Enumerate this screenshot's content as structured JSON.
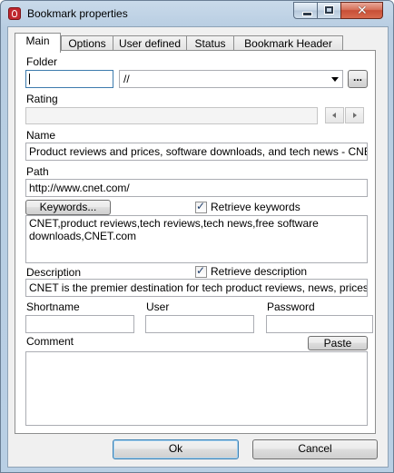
{
  "window": {
    "title": "Bookmark properties"
  },
  "tabs": [
    "Main",
    "Options",
    "User defined",
    "Status",
    "Bookmark Header"
  ],
  "folder": {
    "label": "Folder",
    "path": "//",
    "browse_label": "..."
  },
  "rating": {
    "label": "Rating"
  },
  "name": {
    "label": "Name",
    "value": "Product reviews and prices, software downloads, and tech news - CNET"
  },
  "path": {
    "label": "Path",
    "value": "http://www.cnet.com/"
  },
  "keywords": {
    "button_label": "Keywords...",
    "retrieve_label": "Retrieve keywords",
    "value": "CNET,product reviews,tech reviews,tech news,free software downloads,CNET.com"
  },
  "description": {
    "label": "Description",
    "retrieve_label": "Retrieve description",
    "value": "CNET is the premier destination for tech product reviews, news, prices, videos, forums, how-tos and more."
  },
  "shortname": {
    "label": "Shortname",
    "value": ""
  },
  "user": {
    "label": "User",
    "value": ""
  },
  "password": {
    "label": "Password",
    "value": ""
  },
  "comment": {
    "label": "Comment",
    "paste_label": "Paste",
    "value": ""
  },
  "footer": {
    "ok_label": "Ok",
    "cancel_label": "Cancel"
  }
}
